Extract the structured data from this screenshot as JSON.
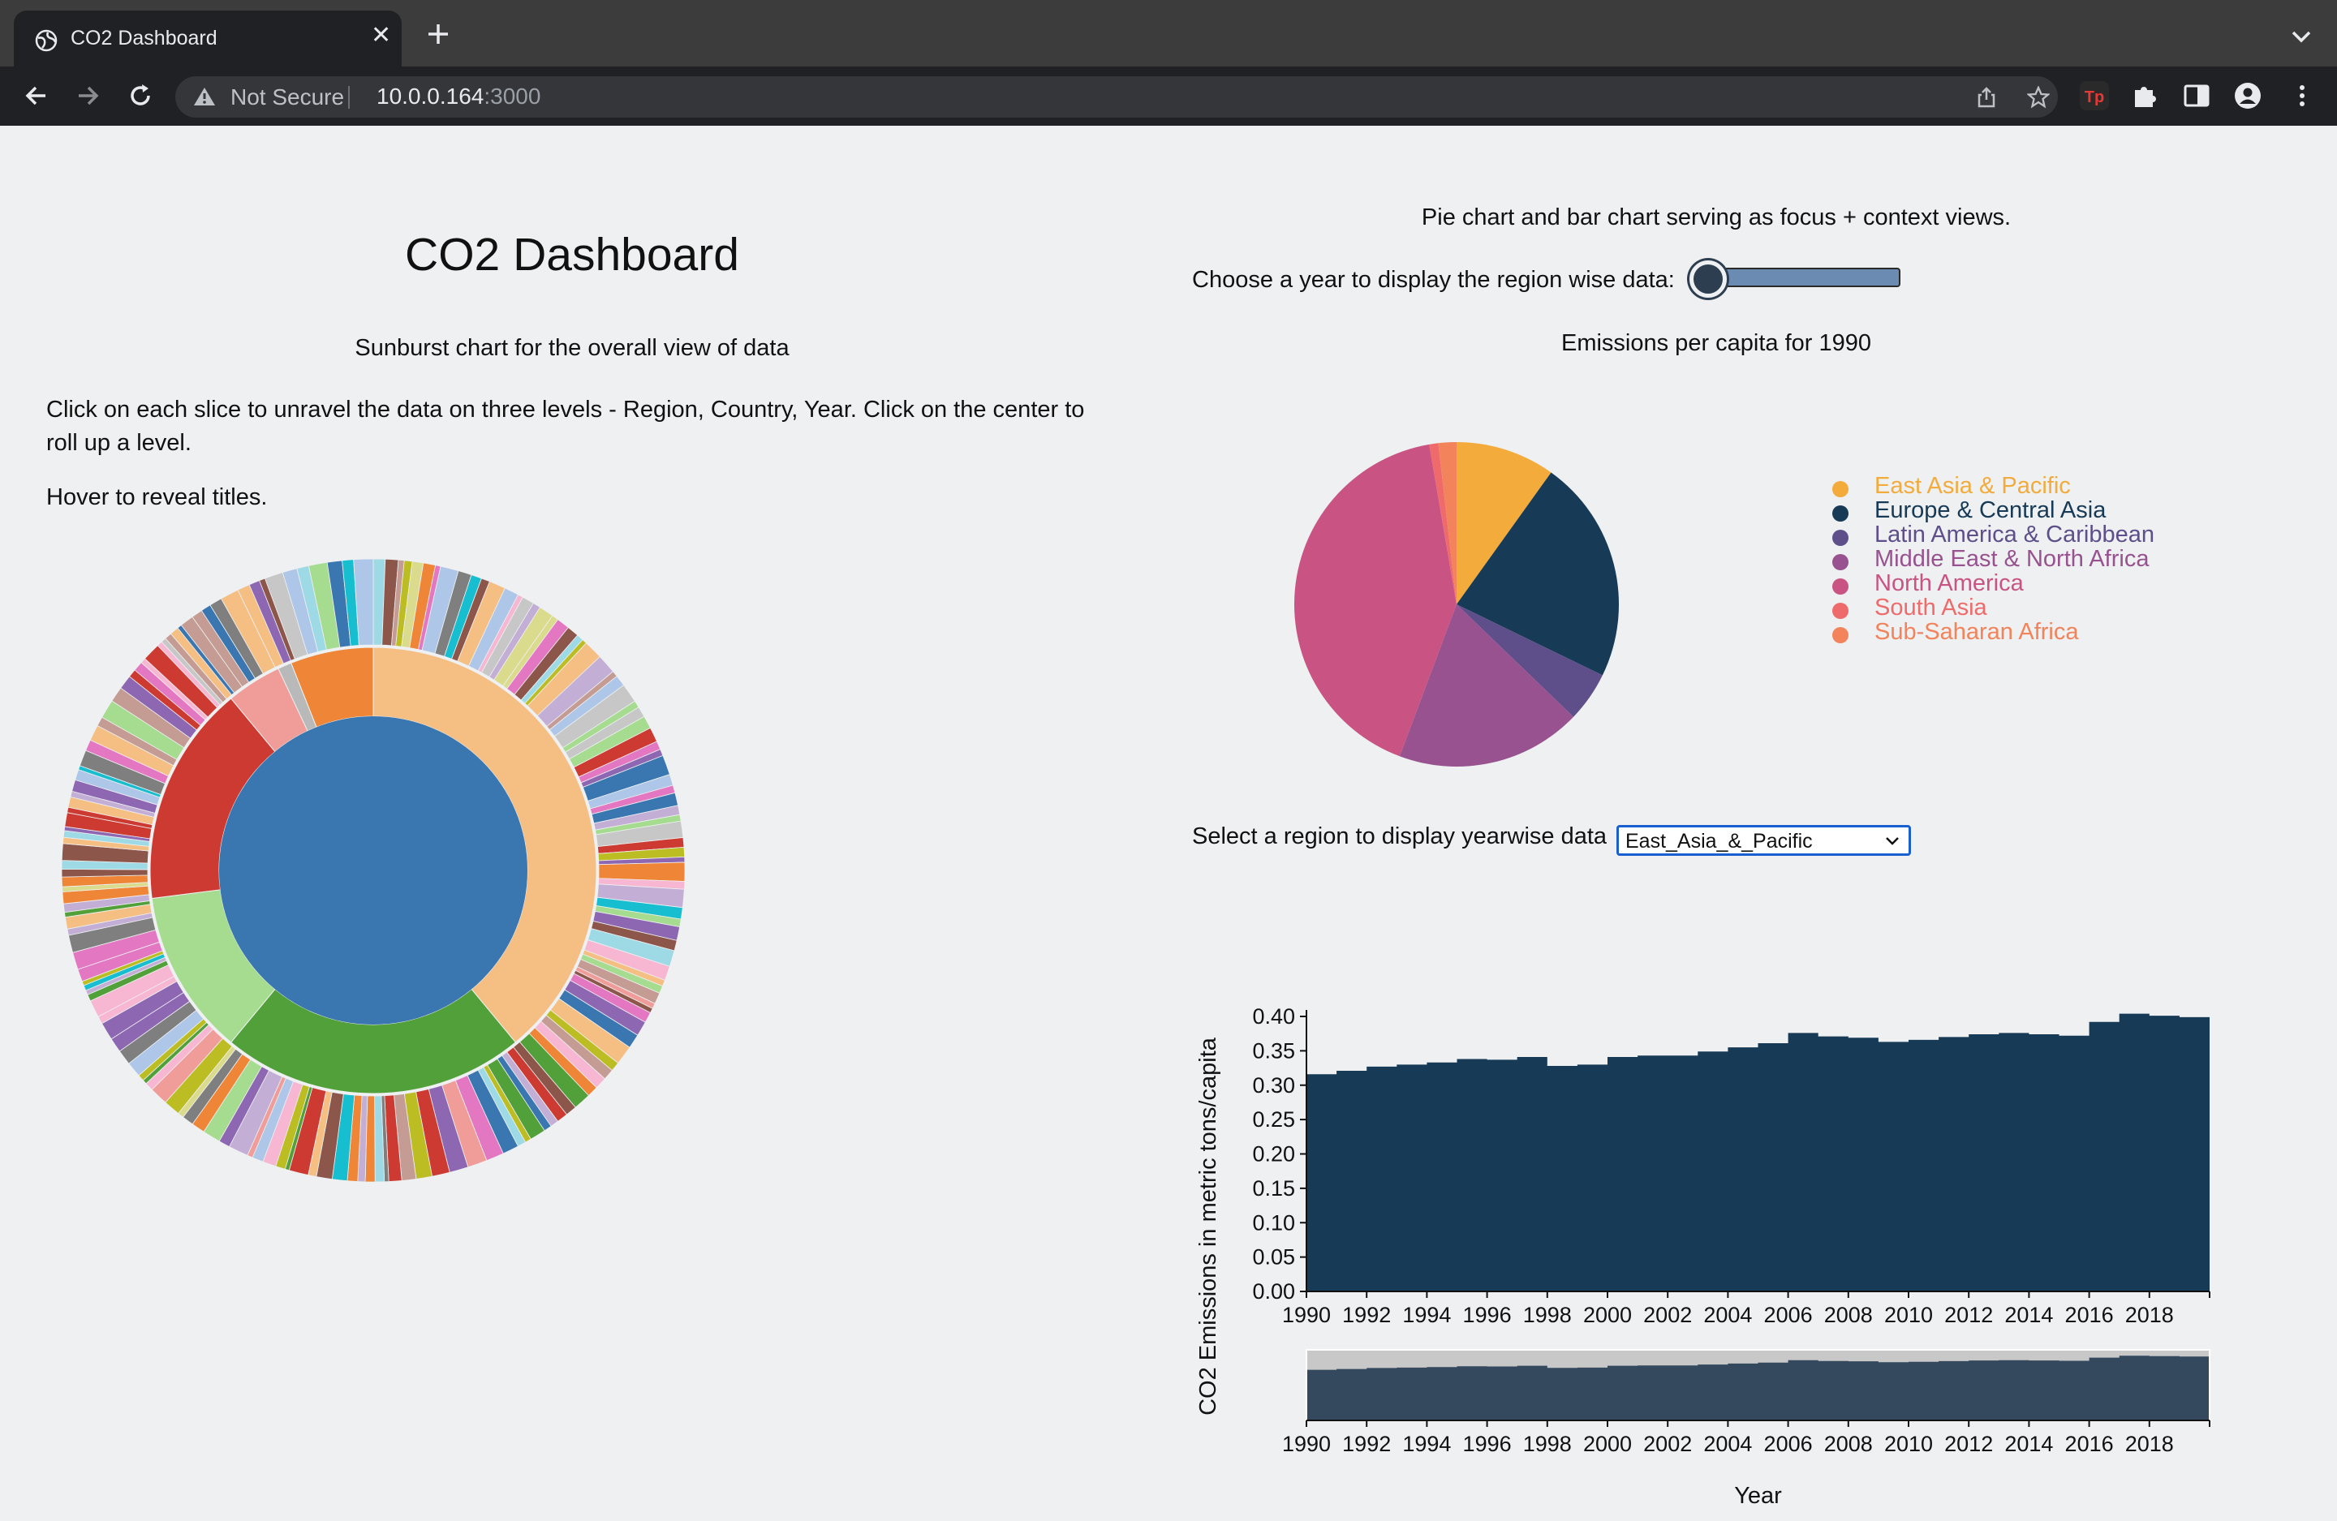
{
  "browser": {
    "tab_title": "CO2 Dashboard",
    "security_label": "Not Secure",
    "url_host": "10.0.0.164",
    "url_port": ":3000"
  },
  "dashboard": {
    "title": "CO2 Dashboard",
    "sunburst_subtitle": "Sunburst chart for the overall view of data",
    "instructions": "Click on each slice to unravel the data on three levels - Region, Country, Year. Click on the center to roll up a level.",
    "hover_note": "Hover to reveal titles.",
    "focus_note": "Pie chart and bar chart serving as focus + context views.",
    "year_label": "Choose a year to display the region wise data:",
    "year_slider": {
      "min": 1990,
      "max": 2019,
      "value": 1990
    },
    "pie_title": "Emissions per capita for 1990",
    "region_label": "Select a region to display yearwise data",
    "region_selected": "East_Asia_&_Pacific"
  },
  "colors": {
    "bar_fill": "#173a56",
    "context_fill": "#34495e",
    "context_bg": "#c8c8c8",
    "slider_track": "#6b8bb3",
    "select_border": "#1a5fd0"
  },
  "chart_data": [
    {
      "type": "pie",
      "title": "Emissions per capita for 1990",
      "categories": [
        "East Asia & Pacific",
        "Europe & Central Asia",
        "Latin America & Caribbean",
        "Middle East & North Africa",
        "North America",
        "South Asia",
        "Sub-Saharan Africa"
      ],
      "values": [
        9.9,
        22.3,
        5.0,
        18.5,
        41.6,
        0.9,
        1.8
      ],
      "colors": [
        "#f3ab3c",
        "#173a56",
        "#5e4f8a",
        "#97528f",
        "#c95483",
        "#ef6a6a",
        "#f2835a"
      ],
      "legend": "right"
    },
    {
      "type": "area",
      "title": "",
      "xlabel": "Year",
      "ylabel": "CO2 Emissions in metric tons/capita",
      "xlim": [
        1990,
        2020
      ],
      "ylim": [
        0,
        0.4
      ],
      "yticks": [
        "0.00",
        "0.05",
        "0.10",
        "0.15",
        "0.20",
        "0.25",
        "0.30",
        "0.35",
        "0.40"
      ],
      "xticks": [
        "1990",
        "1992",
        "1994",
        "1996",
        "1998",
        "2000",
        "2002",
        "2004",
        "2006",
        "2008",
        "2010",
        "2012",
        "2014",
        "2016",
        "2018"
      ],
      "x": [
        1990,
        1991,
        1992,
        1993,
        1994,
        1995,
        1996,
        1997,
        1998,
        1999,
        2000,
        2001,
        2002,
        2003,
        2004,
        2005,
        2006,
        2007,
        2008,
        2009,
        2010,
        2011,
        2012,
        2013,
        2014,
        2015,
        2016,
        2017,
        2018,
        2019
      ],
      "values": [
        0.316,
        0.321,
        0.327,
        0.33,
        0.333,
        0.338,
        0.337,
        0.341,
        0.328,
        0.33,
        0.341,
        0.343,
        0.343,
        0.349,
        0.355,
        0.361,
        0.376,
        0.371,
        0.369,
        0.363,
        0.366,
        0.37,
        0.374,
        0.376,
        0.374,
        0.372,
        0.392,
        0.404,
        0.401,
        0.399
      ],
      "context_view": true
    },
    {
      "type": "sunburst",
      "levels": [
        "Region",
        "Country",
        "Year"
      ],
      "center_color": "#3a76af",
      "inner_ring": [
        {
          "color": "#f5bf84",
          "value": 39
        },
        {
          "color": "#52a039",
          "value": 22
        },
        {
          "color": "#a6dc8f",
          "value": 12
        },
        {
          "color": "#cc3a32",
          "value": 16
        },
        {
          "color": "#f09d9a",
          "value": 4
        },
        {
          "color": "#b9b9b9",
          "value": 1
        },
        {
          "color": "#ef8637",
          "value": 6
        }
      ]
    }
  ]
}
